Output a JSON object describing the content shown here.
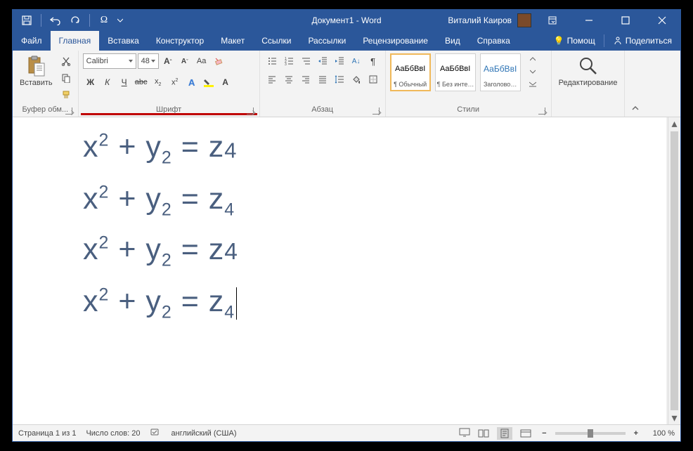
{
  "title": "Документ1 - Word",
  "user": "Виталий Каиров",
  "qat": {
    "save": "save-icon",
    "undo": "undo-icon",
    "redo": "redo-icon",
    "symbol": "omega-icon"
  },
  "tabs": {
    "file": "Файл",
    "items": [
      "Главная",
      "Вставка",
      "Конструктор",
      "Макет",
      "Ссылки",
      "Рассылки",
      "Рецензирование",
      "Вид",
      "Справка"
    ],
    "active_index": 0,
    "tell_me": "Помощ",
    "share": "Поделиться"
  },
  "ribbon": {
    "clipboard": {
      "label": "Буфер обм...",
      "paste": "Вставить"
    },
    "font": {
      "label": "Шрифт",
      "name": "Calibri",
      "size": "48"
    },
    "paragraph": {
      "label": "Абзац"
    },
    "styles": {
      "label": "Стили",
      "preview": "АаБбВвІ",
      "items": [
        {
          "name": "¶ Обычный",
          "selected": true,
          "heading": false
        },
        {
          "name": "¶ Без инте…",
          "selected": false,
          "heading": false
        },
        {
          "name": "Заголово…",
          "selected": false,
          "heading": true
        }
      ]
    },
    "editing": {
      "label": "Редактирование"
    }
  },
  "document": {
    "equations": [
      {
        "text_tokens": [
          "x",
          "2",
          " + y",
          "2",
          " = z",
          "4"
        ],
        "serif": false,
        "cursor": false,
        "style": "mix1"
      },
      {
        "text_tokens": [
          "x",
          "2",
          " + y",
          "2",
          " = z",
          "4"
        ],
        "serif": false,
        "cursor": false,
        "style": "allsub"
      },
      {
        "text_tokens": [
          "x",
          "2",
          " + y",
          "2",
          " = z",
          "4"
        ],
        "serif": true,
        "cursor": false,
        "style": "z4big"
      },
      {
        "text_tokens": [
          "x",
          "2",
          " + y",
          "2",
          " = z",
          "4"
        ],
        "serif": false,
        "cursor": true,
        "style": "allsub"
      }
    ]
  },
  "status": {
    "page": "Страница 1 из 1",
    "words": "Число слов: 20",
    "language": "английский (США)",
    "zoom": "100 %"
  }
}
